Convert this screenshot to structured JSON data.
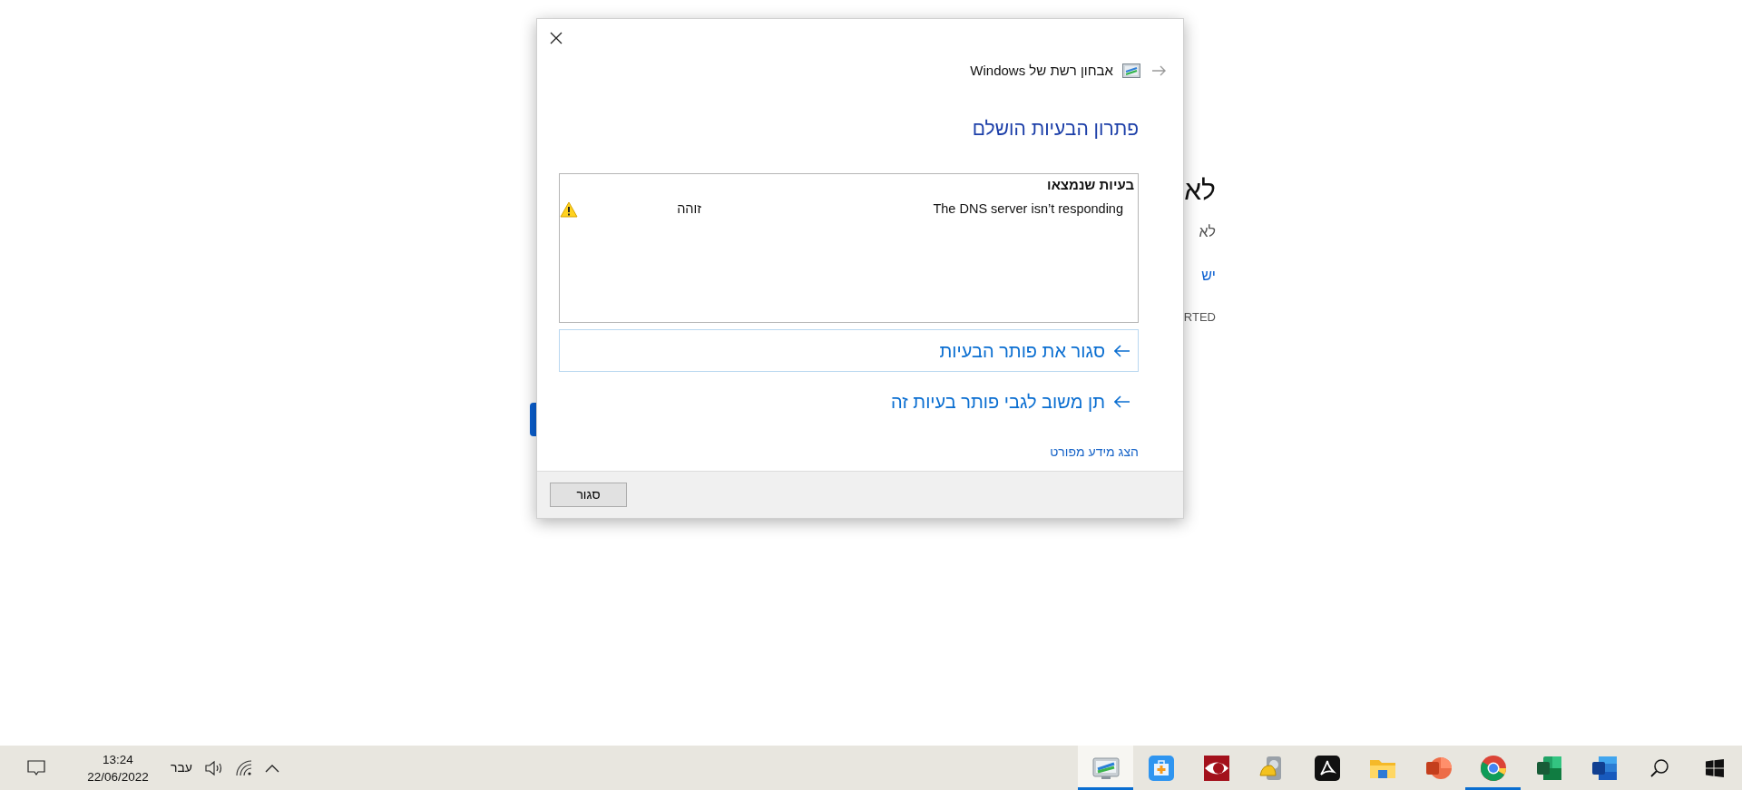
{
  "background_page": {
    "heading": "לא",
    "text": "לא",
    "link": "יש",
    "caption": "RTED"
  },
  "dialog": {
    "breadcrumb": "אבחון רשת של Windows",
    "title": "פתרון הבעיות הושלם",
    "problems": {
      "header": "בעיות שנמצאו",
      "rows": [
        {
          "problem": "The DNS server isn’t responding",
          "status": "זוהה",
          "kind": "warning"
        }
      ]
    },
    "actions": [
      {
        "label": "סגור את פותר הבעיות",
        "focused": true
      },
      {
        "label": "תן משוב לגבי פותר בעיות זה",
        "focused": false
      }
    ],
    "details_link": "הצג מידע מפורט",
    "close_button": "סגור"
  },
  "taskbar": {
    "time": "13:24",
    "date": "22/06/2022",
    "language": "עבר",
    "apps": [
      {
        "kind": "troubleshooter",
        "running": true,
        "selected": true
      },
      {
        "kind": "toolbox",
        "running": false,
        "selected": false
      },
      {
        "kind": "eye",
        "running": false,
        "selected": false
      },
      {
        "kind": "drive",
        "running": false,
        "selected": false
      },
      {
        "kind": "acrobat",
        "running": false,
        "selected": false
      },
      {
        "kind": "folder",
        "running": false,
        "selected": false
      },
      {
        "kind": "powerpoint",
        "running": false,
        "selected": false
      },
      {
        "kind": "chrome",
        "running": true,
        "selected": false
      },
      {
        "kind": "excel",
        "running": false,
        "selected": false
      },
      {
        "kind": "word",
        "running": false,
        "selected": false
      }
    ]
  }
}
